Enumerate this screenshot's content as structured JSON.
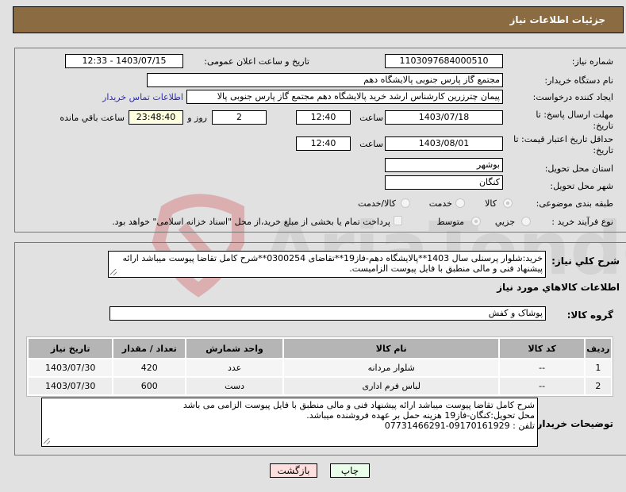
{
  "header": {
    "title": "جزئيات اطلاعات نياز"
  },
  "form": {
    "need_number": {
      "label": "شماره نیاز:",
      "value": "1103097684000510"
    },
    "announce_datetime": {
      "label": "تاریخ و ساعت اعلان عمومی:",
      "value": "1403/07/15 - 12:33"
    },
    "buyer_org": {
      "label": "نام دستگاه خریدار:",
      "value": "مجتمع گاز پارس جنوبی  پالایشگاه دهم"
    },
    "requester": {
      "label": "ایجاد کننده درخواست:",
      "value": "پیمان چترزرین کارشناس ارشد خرید پالایشگاه دهم مجتمع گاز پارس جنوبی  پالا",
      "contact_link": "اطلاعات تماس خریدار"
    },
    "reply_deadline": {
      "label_line1": "مهلت ارسال پاسخ: تا",
      "label_line2": "تاریخ:",
      "date": "1403/07/18",
      "time_label": "ساعت",
      "time": "12:40",
      "days": "2",
      "days_label": "روز و",
      "remaining": "23:48:40",
      "remaining_label": "ساعت باقي مانده"
    },
    "price_validity": {
      "label_line1": "حداقل تاریخ اعتبار قیمت: تا",
      "label_line2": "تاریخ:",
      "date": "1403/08/01",
      "time_label": "ساعت",
      "time": "12:40"
    },
    "province": {
      "label": "استان محل تحویل:",
      "value": "بوشهر"
    },
    "city": {
      "label": "شهر محل تحویل:",
      "value": "کنگان"
    },
    "category": {
      "label": "طبقه بندی موضوعی:",
      "options": [
        {
          "label": "کالا",
          "checked": true
        },
        {
          "label": "خدمت",
          "checked": false
        },
        {
          "label": "کالا/خدمت",
          "checked": false
        }
      ]
    },
    "purchase_process": {
      "label": "نوع فرآیند خرید :",
      "options": [
        {
          "label": "جزیي",
          "checked": false
        },
        {
          "label": "متوسط",
          "checked": true
        }
      ],
      "treasury_checkbox_label": "پرداخت تمام یا بخشی از مبلغ خرید،از محل \"اسناد خزانه اسلامی\" خواهد بود.",
      "treasury_checked": false
    }
  },
  "description": {
    "label": "شرح کلي نياز:",
    "value": "خرید:شلوار پرسنلی سال 1403**پالایشگاه دهم-فاز19**تقاضای 0300254**شرح کامل تقاضا پیوست میباشد ارائه پیشنهاد فنی و مالی منطبق با فایل پیوست الزامیست."
  },
  "goods": {
    "section_title": "اطلاعات کالاهاي مورد نياز",
    "group_label": "گروه کالا:",
    "group_value": "پوشاک و کفش",
    "columns": [
      "ردیف",
      "کد کالا",
      "نام کالا",
      "واحد شمارش",
      "تعداد / مقدار",
      "تاریخ نیاز"
    ],
    "rows": [
      {
        "row": "1",
        "code": "--",
        "name": "شلوار مردانه",
        "unit": "عدد",
        "qty": "420",
        "date": "1403/07/30"
      },
      {
        "row": "2",
        "code": "--",
        "name": "لباس فرم اداری",
        "unit": "دست",
        "qty": "600",
        "date": "1403/07/30"
      }
    ]
  },
  "buyer_notes": {
    "label": "توضیحات خریدار:",
    "lines": [
      "شرح کامل تقاضا پیوست میباشد ارائه پیشنهاد فنی و مالی منطبق با فایل پیوست الزامی می باشد",
      "محل تحویل:کنگان-فاز19 هزینه حمل بر عهده فروشنده میباشد.",
      "تلفن : 09170161929-07731466291"
    ]
  },
  "buttons": {
    "print": "چاپ",
    "back": "بازگشت"
  },
  "watermark": {
    "text": "AriaTender.net"
  },
  "colors": {
    "header_bg": "#8b6b42",
    "print_bg": "#eaffea",
    "back_bg": "#ffdede",
    "link": "#2c2cb8"
  }
}
